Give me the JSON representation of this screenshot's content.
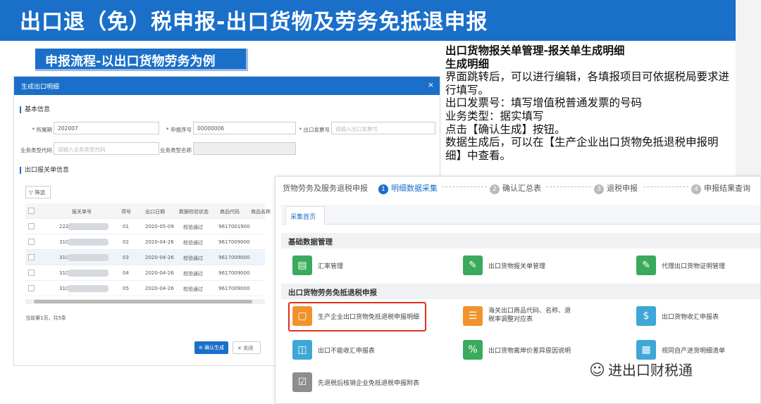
{
  "title": "出口退（免）税申报-出口货物及劳务免抵退申报",
  "subtitle": "申报流程-以出口货物劳务为例",
  "description": {
    "heading": "出口货物报关单管理-报关单生成明细",
    "subheading": "生成明细",
    "lines": [
      "界面跳转后，可以进行编辑，各填报项目可依据税局要求进行填写。",
      "出口发票号：填写增值税普通发票的号码",
      "业务类型：据实填写",
      "点击【确认生成】按钮。",
      "数据生成后，可以在【生产企业出口货物免抵退税申报明细】中查看。"
    ]
  },
  "dialog": {
    "title": "生成出口明细",
    "close": "×",
    "section_basic": "基本信息",
    "section_list": "出口报关单信息",
    "fields": {
      "period_label": "* 所属期",
      "period_value": "202007",
      "seq_label": "* 申报序号",
      "seq_value": "00000006",
      "invoice_label": "* 出口发票号",
      "invoice_placeholder": "请输入出口发票号",
      "biztype_label": "业务类型代码",
      "biztype_placeholder": "请输入业务类型代码",
      "bizname_label": "业务类型名称"
    },
    "filter": "▽ 筛选",
    "table": {
      "headers": [
        "报关单号",
        "项号",
        "出口日期",
        "数据校验状态",
        "商品代码",
        "商品名称"
      ],
      "rows": [
        {
          "no": "222",
          "item": "01",
          "date": "2020-05-09",
          "status": "校验通过",
          "code": "9617001900"
        },
        {
          "no": "310",
          "item": "02",
          "date": "2020-04-26",
          "status": "校验通过",
          "code": "9617009000"
        },
        {
          "no": "310",
          "item": "03",
          "date": "2020-04-26",
          "status": "校验通过",
          "code": "9617009000"
        },
        {
          "no": "310",
          "item": "04",
          "date": "2020-04-26",
          "status": "校验通过",
          "code": "9617009000"
        },
        {
          "no": "310",
          "item": "05",
          "date": "2020-04-26",
          "status": "校验通过",
          "code": "9617009000"
        }
      ]
    },
    "pager": "当前第1页，共5条",
    "ok": "⊘ 确认生成",
    "close_btn": "✕ 关闭"
  },
  "panel": {
    "steps": {
      "prefix": "货物劳务及服务退税申报",
      "s1": "明细数据采集",
      "s2": "确认汇总表",
      "s3": "退税申报",
      "s4": "申报结果查询",
      "n1": "1",
      "n2": "2",
      "n3": "3",
      "n4": "4"
    },
    "tab": "采集首页",
    "group1": "基础数据管理",
    "group2": "出口货物劳务免抵退税申报",
    "items": {
      "i1": "汇率管理",
      "i2": "出口货物报关单管理",
      "i3": "代理出口货物证明管理",
      "i4": "生产企业出口货物免抵退税申报明细",
      "i5": "海关出口商品代码、名称、退税率调整对应表",
      "i6": "出口货物收汇申报表",
      "i7": "出口不能收汇申报表",
      "i8": "出口货物离岸价差异原因说明",
      "i9": "视同自产进货明细清单",
      "i10": "先退税后核销企业免抵退税申报附表"
    }
  },
  "watermark": "进出口财税通",
  "colors": {
    "brand": "#1a6fc9",
    "green": "#3aaa5c",
    "orange": "#f0932b",
    "teal": "#3fa7d6",
    "gray": "#8e8e8e",
    "highlight": "#e03020"
  }
}
